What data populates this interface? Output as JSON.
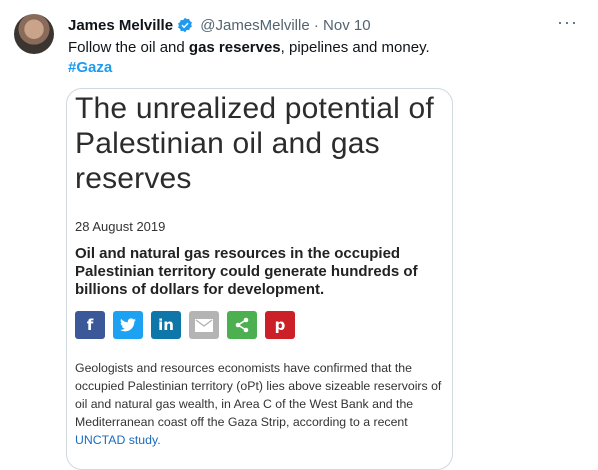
{
  "tweet": {
    "author_name": "James Melville",
    "handle": "@JamesMelville",
    "separator": "·",
    "date": "Nov 10",
    "more_label": "···",
    "text_before": "Follow the oil and ",
    "text_bold": "gas reserves",
    "text_after": ", pipelines and money.",
    "hashtag": "#Gaza"
  },
  "article": {
    "title": "The unrealized potential of Palestinian oil and gas reserves",
    "date": "28 August 2019",
    "lead": "Oil and natural gas resources in the occupied Palestinian territory could generate hundreds of billions of dollars for development.",
    "share_buttons": [
      "f",
      "twitter",
      "in",
      "email",
      "share",
      "p"
    ],
    "share_colors": [
      "#3b5998",
      "#1da1f2",
      "#0e76a8",
      "#b4b4b4",
      "#4caf50",
      "#cb2027"
    ],
    "body": "Geologists and resources economists have confirmed that the occupied Palestinian territory (oPt) lies above sizeable reservoirs of oil and natural gas wealth, in Area C of the West Bank and the Mediterranean coast off the Gaza Strip, according to a recent ",
    "body_link": "UNCTAD study."
  }
}
